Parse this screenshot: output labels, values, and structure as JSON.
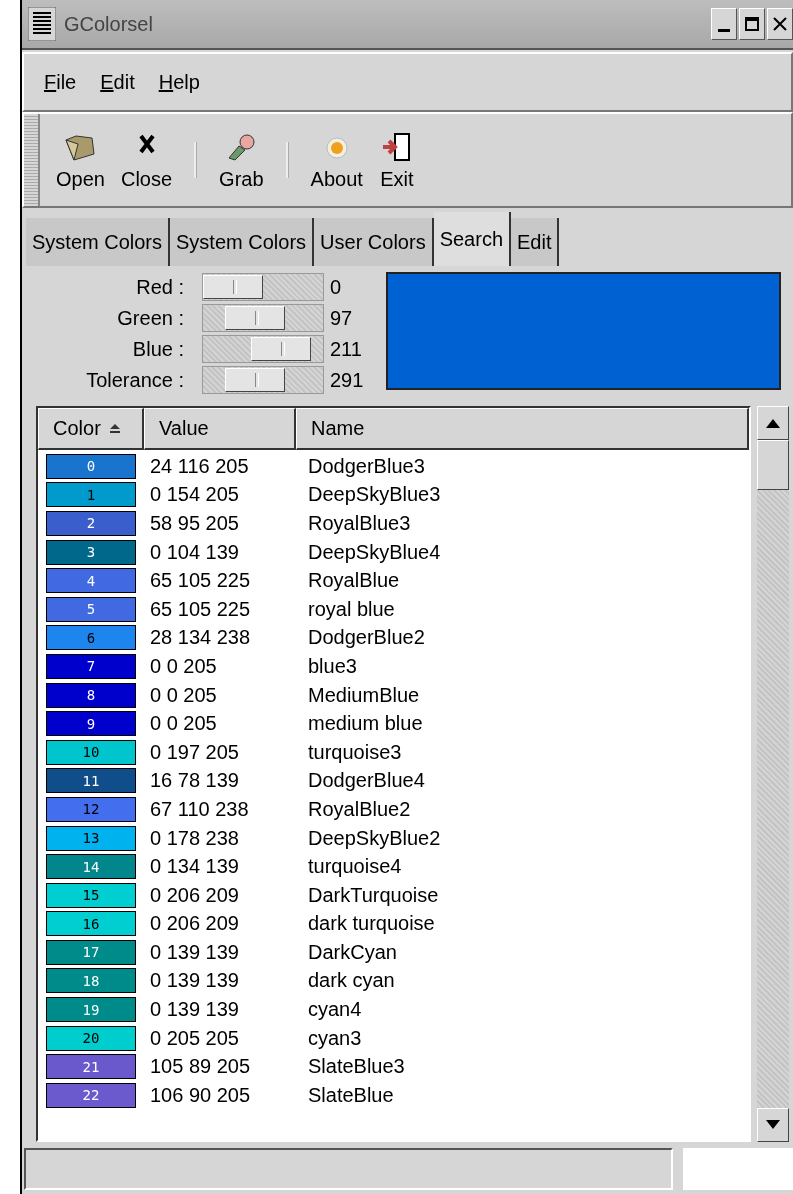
{
  "window": {
    "title": "GColorsel"
  },
  "menu": [
    {
      "label": "File"
    },
    {
      "label": "Edit"
    },
    {
      "label": "Help"
    }
  ],
  "toolbar": [
    {
      "kind": "folder",
      "label": "Open"
    },
    {
      "kind": "cross",
      "label": "Close"
    },
    {
      "kind": "separator"
    },
    {
      "kind": "dropper",
      "label": "Grab"
    },
    {
      "kind": "separator"
    },
    {
      "kind": "flower",
      "label": "About"
    },
    {
      "kind": "door",
      "label": "Exit"
    }
  ],
  "tabs": [
    {
      "label": "System Colors",
      "selected": false
    },
    {
      "label": "System Colors",
      "selected": false
    },
    {
      "label": "User Colors",
      "selected": false
    },
    {
      "label": "Search",
      "selected": true
    },
    {
      "label": "Edit",
      "selected": false
    }
  ],
  "sliders": [
    {
      "label": "Red :",
      "level": 0,
      "reading": "0"
    },
    {
      "label": "Green :",
      "level": 0.38,
      "reading": "97"
    },
    {
      "label": "Blue :",
      "level": 0.83,
      "reading": "211"
    },
    {
      "label": "Tolerance :",
      "level": 0.38,
      "reading": "291"
    }
  ],
  "preview": {
    "color": "#0061d3"
  },
  "table": {
    "columns": [
      {
        "label": "Color",
        "sorted": true
      },
      {
        "label": "Value",
        "sorted": false
      },
      {
        "label": "Name",
        "sorted": false
      }
    ],
    "rows": [
      {
        "index": "0",
        "value": "24 116 205",
        "name": "DodgerBlue3",
        "color": "#1874cd"
      },
      {
        "index": "1",
        "value": "0 154 205",
        "name": "DeepSkyBlue3",
        "color": "#009acd"
      },
      {
        "index": "2",
        "value": "58 95 205",
        "name": "RoyalBlue3",
        "color": "#3a5fcd"
      },
      {
        "index": "3",
        "value": "0 104 139",
        "name": "DeepSkyBlue4",
        "color": "#00688b"
      },
      {
        "index": "4",
        "value": "65 105 225",
        "name": "RoyalBlue",
        "color": "#4169e1"
      },
      {
        "index": "5",
        "value": "65 105 225",
        "name": "royal blue",
        "color": "#4169e1"
      },
      {
        "index": "6",
        "value": "28 134 238",
        "name": "DodgerBlue2",
        "color": "#1c86ee"
      },
      {
        "index": "7",
        "value": "0 0 205",
        "name": "blue3",
        "color": "#0000cd"
      },
      {
        "index": "8",
        "value": "0 0 205",
        "name": "MediumBlue",
        "color": "#0000cd"
      },
      {
        "index": "9",
        "value": "0 0 205",
        "name": "medium blue",
        "color": "#0000cd"
      },
      {
        "index": "10",
        "value": "0 197 205",
        "name": "turquoise3",
        "color": "#00c5cd"
      },
      {
        "index": "11",
        "value": "16 78 139",
        "name": "DodgerBlue4",
        "color": "#104e8b"
      },
      {
        "index": "12",
        "value": "67 110 238",
        "name": "RoyalBlue2",
        "color": "#436eee"
      },
      {
        "index": "13",
        "value": "0 178 238",
        "name": "DeepSkyBlue2",
        "color": "#00b2ee"
      },
      {
        "index": "14",
        "value": "0 134 139",
        "name": "turquoise4",
        "color": "#00868b"
      },
      {
        "index": "15",
        "value": "0 206 209",
        "name": "DarkTurquoise",
        "color": "#00ced1"
      },
      {
        "index": "16",
        "value": "0 206 209",
        "name": "dark turquoise",
        "color": "#00ced1"
      },
      {
        "index": "17",
        "value": "0 139 139",
        "name": "DarkCyan",
        "color": "#008b8b"
      },
      {
        "index": "18",
        "value": "0 139 139",
        "name": "dark cyan",
        "color": "#008b8b"
      },
      {
        "index": "19",
        "value": "0 139 139",
        "name": "cyan4",
        "color": "#008b8b"
      },
      {
        "index": "20",
        "value": "0 205 205",
        "name": "cyan3",
        "color": "#00cdcd"
      },
      {
        "index": "21",
        "value": "105 89 205",
        "name": "SlateBlue3",
        "color": "#6959cd"
      },
      {
        "index": "22",
        "value": "106 90 205",
        "name": "SlateBlue",
        "color": "#6a5acd"
      }
    ]
  }
}
